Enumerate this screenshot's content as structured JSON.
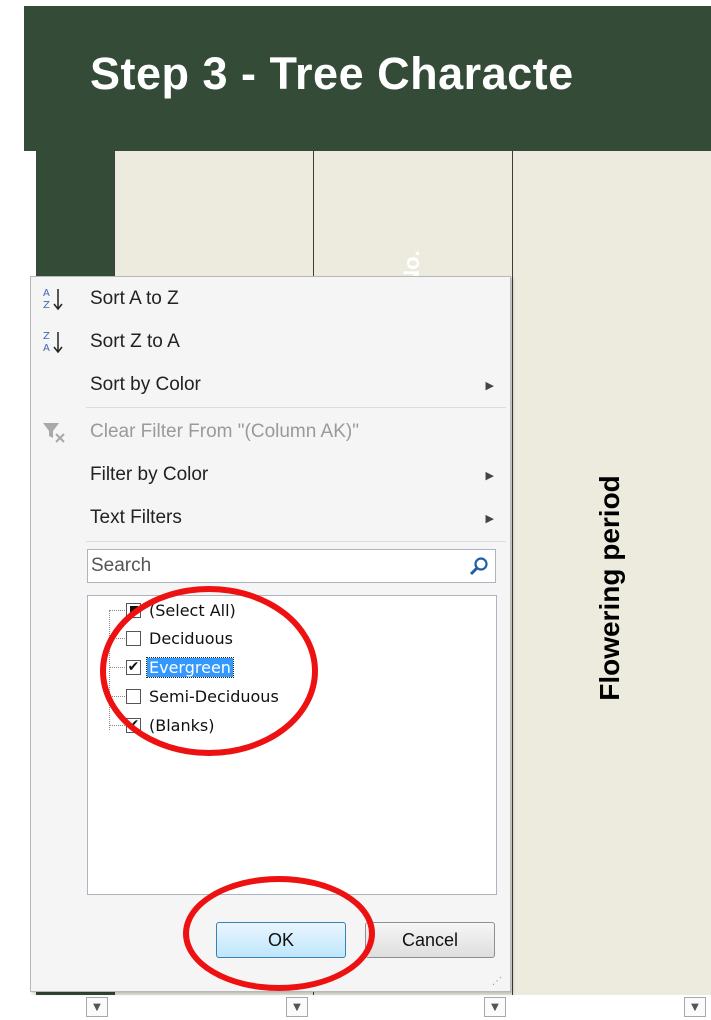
{
  "sheet": {
    "title": "Step 3 - Tree Characte",
    "col_b_header": "No.",
    "col_c_header": "Flowering period"
  },
  "filter_menu": {
    "sort_az": "Sort A to Z",
    "sort_za": "Sort Z to A",
    "sort_by_color": "Sort by Color",
    "clear_filter": "Clear Filter From \"(Column AK)\"",
    "filter_by_color": "Filter by Color",
    "text_filters": "Text Filters",
    "search_placeholder": "Search",
    "items": [
      {
        "label": "(Select All)",
        "state": "partial"
      },
      {
        "label": "Deciduous",
        "state": "unchecked"
      },
      {
        "label": "Evergreen",
        "state": "checked",
        "selected": true
      },
      {
        "label": "Semi-Deciduous",
        "state": "unchecked"
      },
      {
        "label": "(Blanks)",
        "state": "checked"
      }
    ],
    "ok_label": "OK",
    "cancel_label": "Cancel"
  },
  "colors": {
    "banner": "#344b37",
    "cell_fill": "#ecebde",
    "annotation": "#ee1111",
    "selection": "#3399ff"
  }
}
